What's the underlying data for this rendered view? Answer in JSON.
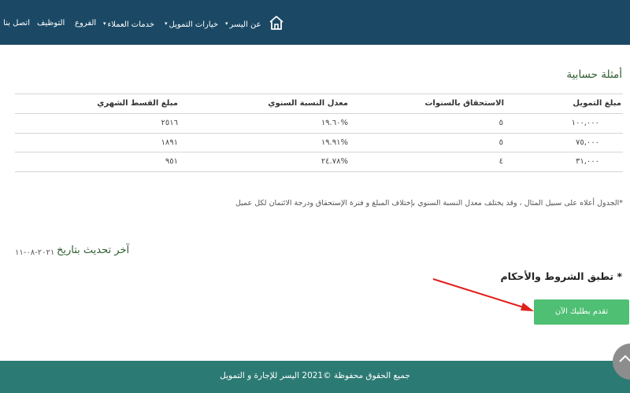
{
  "nav": {
    "home_icon": "house-outline-icon",
    "items": [
      {
        "label": "عن اليسر",
        "has_caret": true
      },
      {
        "label": "خيارات التمويل",
        "has_caret": true
      },
      {
        "label": "خدمات العملاء",
        "has_caret": true
      },
      {
        "label": "الفروع",
        "has_caret": false
      },
      {
        "label": "التوظيف",
        "has_caret": false
      },
      {
        "label": "اتصل بنا",
        "has_caret": false
      }
    ],
    "caret_glyph": "▾"
  },
  "main": {
    "heading": "أمثلة حسابية",
    "table": {
      "headers": {
        "amount": "مبلغ التمويل",
        "years": "الاستحقاق بالسنوات",
        "rate": "معدل النسبة السنوي",
        "installment": "مبلغ القسط الشهري"
      },
      "rows": [
        {
          "amount": "١٠٠,٠٠٠",
          "years": "٥",
          "rate": "١٩.٦٠%",
          "installment": "٢٥١٦"
        },
        {
          "amount": "٧٥,٠٠٠",
          "years": "٥",
          "rate": "١٩.٩١%",
          "installment": "١٨٩١"
        },
        {
          "amount": "٣١,٠٠٠",
          "years": "٤",
          "rate": "٢٤.٧٨%",
          "installment": "٩٥١"
        }
      ]
    },
    "footnote": "*الجدول أعلاه على سبيل المثال ، وقد يختلف معدل النسبة السنوي بإختلاف المبلغ و فترة الإستحقاق ودرجة الائتمان لكل عميل",
    "update_label": "آخر تحديث بتاريخ",
    "update_date": "٢٠٢١-٠٨-١١",
    "terms": "* تطبق الشروط والأحكام",
    "apply_button": "تقدم بطلبك الآن"
  },
  "footer": {
    "text": "جميع الحقوق محفوظة ©2021 اليسر للإجارة و التمويل",
    "background": "#2c7a74"
  },
  "colors": {
    "nav_bg": "#1b4965",
    "accent_green": "#4fbf73",
    "heading_green": "#2f5d2f",
    "arrow_red": "#e0201c"
  }
}
